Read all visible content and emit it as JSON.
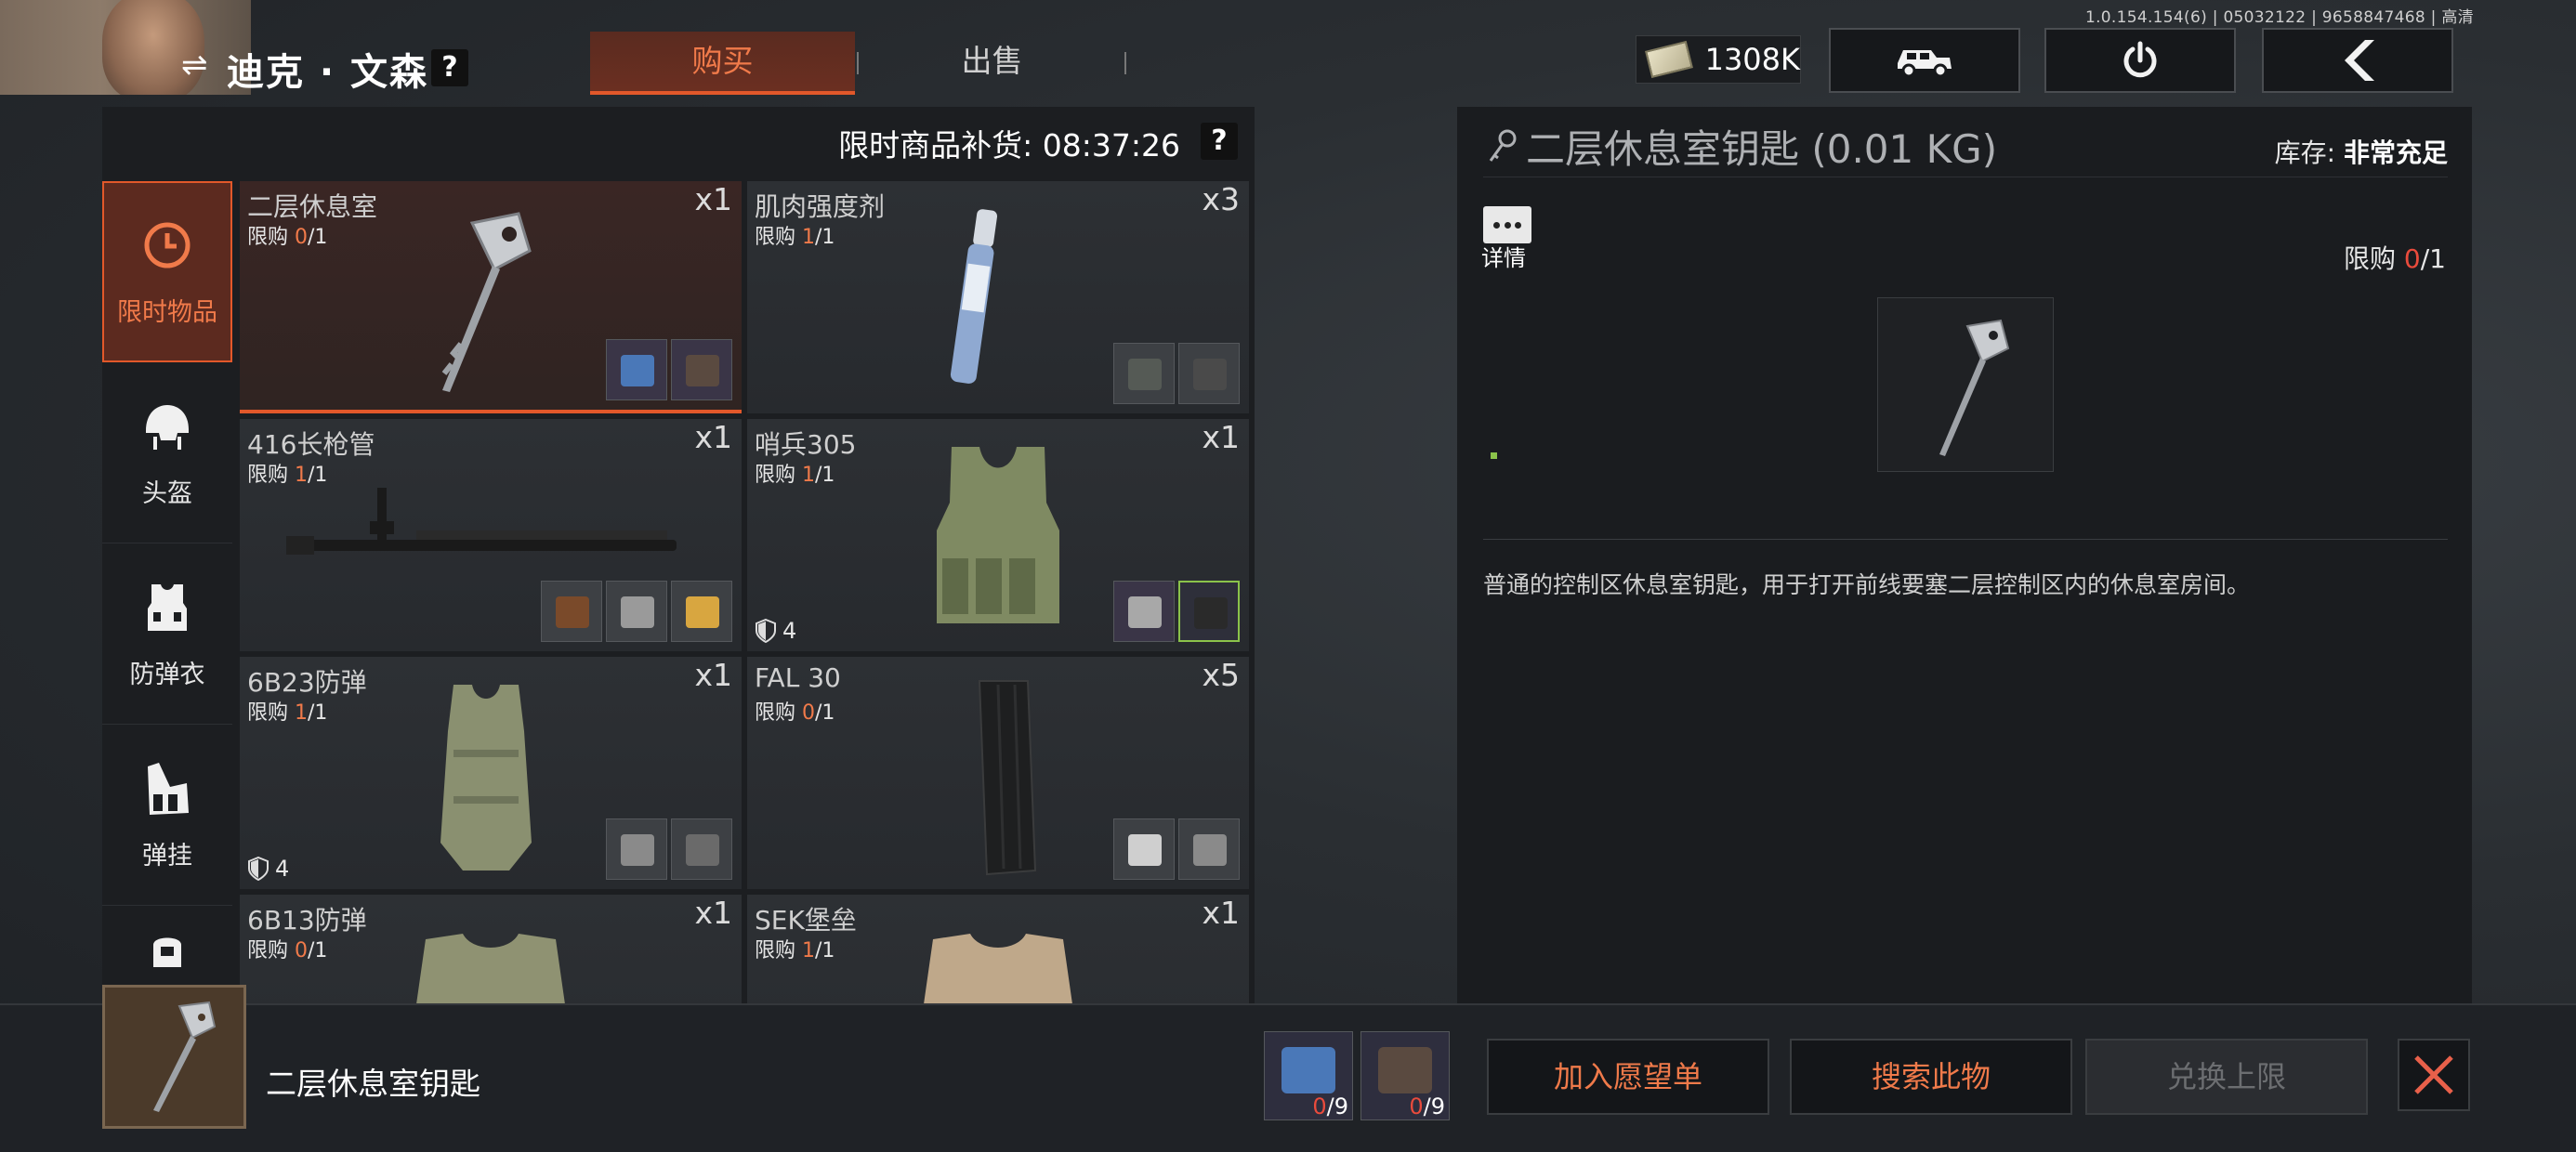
{
  "version": "1.0.154.154(6) | 05032122 | 9658847468 | 高清",
  "trader": {
    "swap_icon": "swap-icon",
    "name": "迪克 · 文森",
    "help": "?"
  },
  "tabs": [
    {
      "label": "购买",
      "active": true
    },
    {
      "label": "出售",
      "active": false
    }
  ],
  "currency": {
    "icon": "cash-icon",
    "amount": "1308K"
  },
  "top_buttons": [
    "vehicle-icon",
    "power-icon",
    "back-icon"
  ],
  "restock": {
    "label": "限时商品补货: 08:37:26",
    "help": "?"
  },
  "categories": [
    {
      "label": "限时物品",
      "icon": "clock-icon",
      "active": true
    },
    {
      "label": "头盔",
      "icon": "helmet-icon",
      "active": false
    },
    {
      "label": "防弹衣",
      "icon": "vest-icon",
      "active": false
    },
    {
      "label": "弹挂",
      "icon": "rig-icon",
      "active": false
    },
    {
      "label": "",
      "icon": "backpack-icon",
      "active": false
    }
  ],
  "items": [
    {
      "name": "二层休息室",
      "limit_prefix": "限购 ",
      "limit_used": "0",
      "limit_total": "/1",
      "qty": "x1",
      "armor": "",
      "selected": true
    },
    {
      "name": "肌肉强度剂",
      "limit_prefix": "限购 ",
      "limit_used": "1",
      "limit_total": "/1",
      "qty": "x3",
      "armor": "",
      "selected": false
    },
    {
      "name": "416长枪管",
      "limit_prefix": "限购 ",
      "limit_used": "1",
      "limit_total": "/1",
      "qty": "x1",
      "armor": "",
      "selected": false
    },
    {
      "name": "哨兵305",
      "limit_prefix": "限购 ",
      "limit_used": "1",
      "limit_total": "/1",
      "qty": "x1",
      "armor": "4",
      "selected": false
    },
    {
      "name": "6B23防弹",
      "limit_prefix": "限购 ",
      "limit_used": "1",
      "limit_total": "/1",
      "qty": "x1",
      "armor": "4",
      "selected": false
    },
    {
      "name": "FAL 30",
      "limit_prefix": "限购 ",
      "limit_used": "0",
      "limit_total": "/1",
      "qty": "x5",
      "armor": "",
      "selected": false
    },
    {
      "name": "6B13防弹",
      "limit_prefix": "限购 ",
      "limit_used": "0",
      "limit_total": "/1",
      "qty": "x1",
      "armor": "",
      "selected": false
    },
    {
      "name": "SEK堡垒",
      "limit_prefix": "限购 ",
      "limit_used": "1",
      "limit_total": "/1",
      "qty": "x1",
      "armor": "",
      "selected": false
    }
  ],
  "detail": {
    "title": "二层休息室钥匙 (0.01 KG)",
    "stock_label": "库存: ",
    "stock_value": "非常充足",
    "info_label": "详情",
    "limit_prefix": "限购 ",
    "limit_used": "0",
    "limit_total": "/1",
    "description": "普通的控制区休息室钥匙，用于打开前线要塞二层控制区内的休息室房间。"
  },
  "bottom": {
    "selected_name": "二层休息室钥匙",
    "requirements": [
      {
        "icon": "circuit-board-icon",
        "have": "0",
        "need": "/9"
      },
      {
        "icon": "camera-icon",
        "have": "0",
        "need": "/9"
      }
    ],
    "actions": {
      "wishlist": "加入愿望单",
      "search": "搜索此物",
      "exchange": "兑换上限"
    }
  }
}
